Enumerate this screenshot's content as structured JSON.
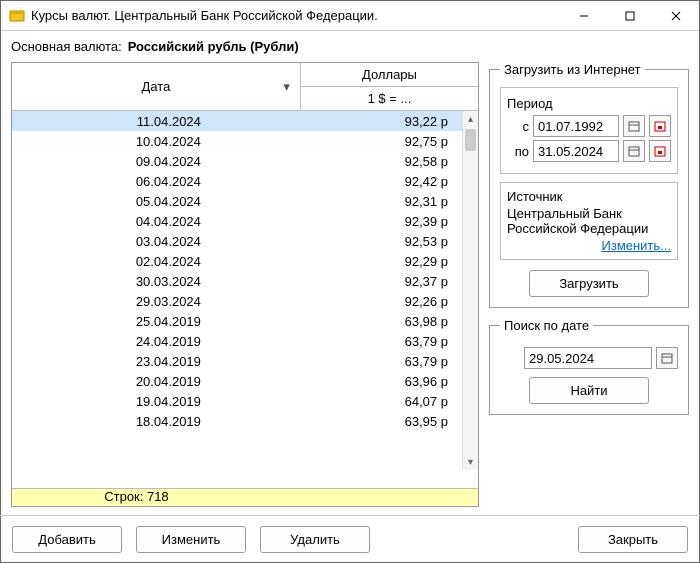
{
  "window": {
    "title": "Курсы валют. Центральный Банк Российской Федерации."
  },
  "header": {
    "label": "Основная валюта:",
    "currency": "Российский рубль (Рубли)"
  },
  "table": {
    "col_date": "Дата",
    "col_currency": "Доллары",
    "col_rate": "1 $ = ...",
    "rows": [
      {
        "date": "11.04.2024",
        "value": "93,22 р"
      },
      {
        "date": "10.04.2024",
        "value": "92,75 р"
      },
      {
        "date": "09.04.2024",
        "value": "92,58 р"
      },
      {
        "date": "06.04.2024",
        "value": "92,42 р"
      },
      {
        "date": "05.04.2024",
        "value": "92,31 р"
      },
      {
        "date": "04.04.2024",
        "value": "92,39 р"
      },
      {
        "date": "03.04.2024",
        "value": "92,53 р"
      },
      {
        "date": "02.04.2024",
        "value": "92,29 р"
      },
      {
        "date": "30.03.2024",
        "value": "92,37 р"
      },
      {
        "date": "29.03.2024",
        "value": "92,26 р"
      },
      {
        "date": "25.04.2019",
        "value": "63,98 р"
      },
      {
        "date": "24.04.2019",
        "value": "63,79 р"
      },
      {
        "date": "23.04.2019",
        "value": "63,79 р"
      },
      {
        "date": "20.04.2019",
        "value": "63,96 р"
      },
      {
        "date": "19.04.2019",
        "value": "64,07 р"
      },
      {
        "date": "18.04.2019",
        "value": "63,95 р"
      }
    ],
    "footer_label": "Строк: 718"
  },
  "load_panel": {
    "title": "Загрузить из Интернет",
    "period_label": "Период",
    "from_label": "с",
    "from_value": "01.07.1992",
    "to_label": "по",
    "to_value": "31.05.2024",
    "source_label": "Источник",
    "source_value": "Центральный Банк Российской Федерации",
    "change_link": "Изменить...",
    "load_button": "Загрузить"
  },
  "search_panel": {
    "title": "Поиск по дате",
    "date_value": "29.05.2024",
    "find_button": "Найти"
  },
  "footer": {
    "add": "Добавить",
    "edit": "Изменить",
    "delete": "Удалить",
    "close": "Закрыть"
  }
}
